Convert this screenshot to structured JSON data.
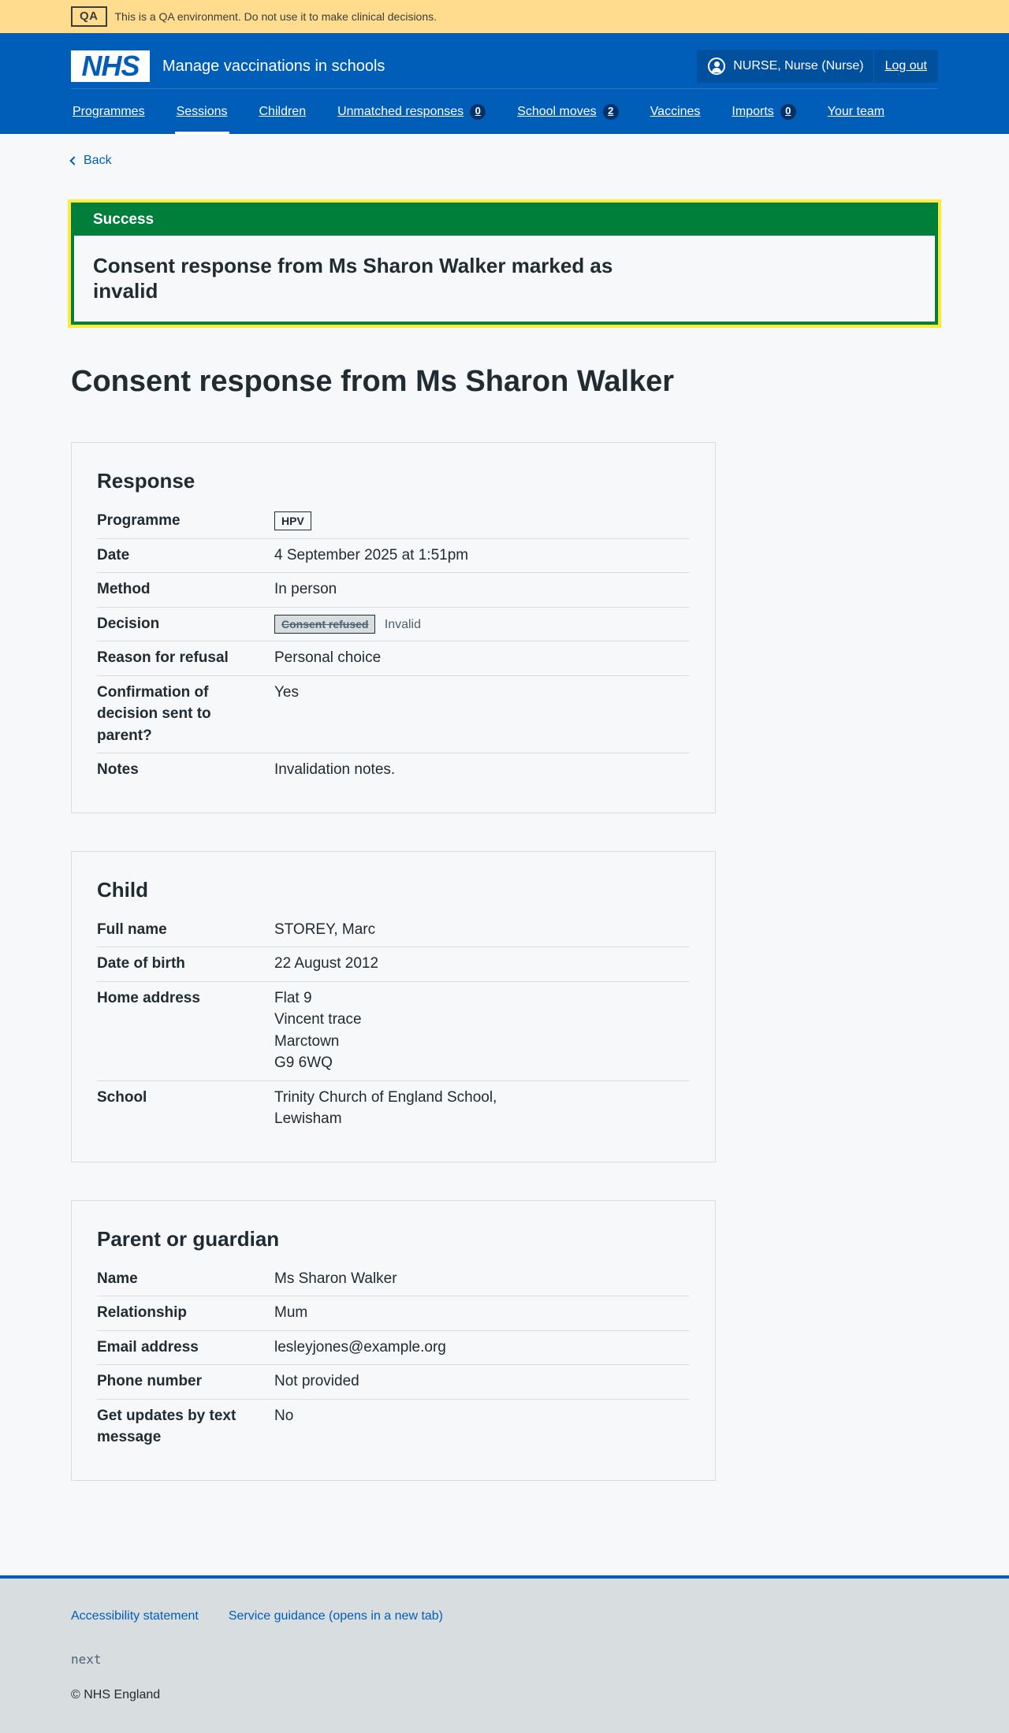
{
  "qa_banner": {
    "tag": "QA",
    "text": "This is a QA environment. Do not use it to make clinical decisions."
  },
  "header": {
    "logo": "NHS",
    "service_name": "Manage vaccinations in schools",
    "user": "NURSE, Nurse (Nurse)",
    "logout": "Log out"
  },
  "nav": {
    "programmes": "Programmes",
    "sessions": "Sessions",
    "children": "Children",
    "unmatched": "Unmatched responses",
    "unmatched_count": "0",
    "school_moves": "School moves",
    "school_moves_count": "2",
    "vaccines": "Vaccines",
    "imports": "Imports",
    "imports_count": "0",
    "your_team": "Your team",
    "active": "Sessions"
  },
  "back": "Back",
  "success": {
    "heading": "Success",
    "message": "Consent response from Ms Sharon Walker marked as invalid"
  },
  "title": "Consent response from Ms Sharon Walker",
  "response": {
    "heading": "Response",
    "programme_label": "Programme",
    "programme": "HPV",
    "date_label": "Date",
    "date": "4 September 2025 at 1:51pm",
    "method_label": "Method",
    "method": "In person",
    "decision_label": "Decision",
    "decision": "Consent refused",
    "decision_hint": "Invalid",
    "reason_label": "Reason for refusal",
    "reason": "Personal choice",
    "confirmation_label": "Confirmation of decision sent to parent?",
    "confirmation": "Yes",
    "notes_label": "Notes",
    "notes": "Invalidation notes."
  },
  "child": {
    "heading": "Child",
    "name_label": "Full name",
    "name": "STOREY, Marc",
    "dob_label": "Date of birth",
    "dob": "22 August 2012",
    "address_label": "Home address",
    "address": [
      "Flat 9",
      "Vincent trace",
      "Marctown",
      "G9 6WQ"
    ],
    "school_label": "School",
    "school": "Trinity Church of England School, Lewisham"
  },
  "parent": {
    "heading": "Parent or guardian",
    "name_label": "Name",
    "name": "Ms Sharon Walker",
    "relationship_label": "Relationship",
    "relationship": "Mum",
    "email_label": "Email address",
    "email": "lesleyjones@example.org",
    "phone_label": "Phone number",
    "phone": "Not provided",
    "updates_label": "Get updates by text message",
    "updates": "No"
  },
  "footer": {
    "accessibility": "Accessibility statement",
    "guidance": "Service guidance (opens in a new tab)",
    "version": "next",
    "copyright": "© NHS England"
  },
  "colors": {
    "brand": "#005eb8",
    "success": "#007f3b",
    "qa": "#ffdc8e",
    "focus": "#ffeb3b"
  }
}
